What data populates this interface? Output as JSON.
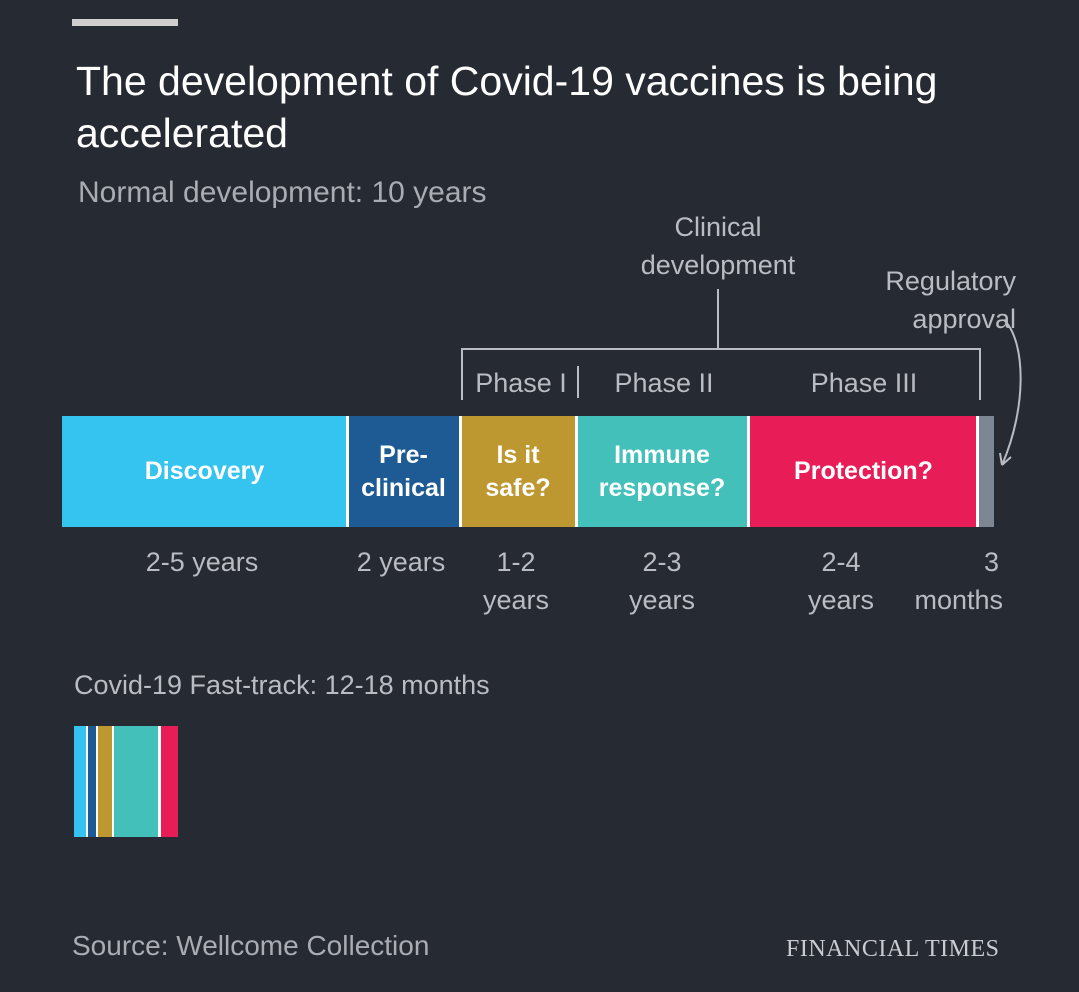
{
  "title": "The development of Covid-19 vaccines is being accelerated",
  "subtitle": "Normal development: 10 years",
  "clinical_label_line1": "Clinical",
  "clinical_label_line2": "development",
  "regulatory_label_line1": "Regulatory",
  "regulatory_label_line2": "approval",
  "phases": [
    "Phase I",
    "Phase II",
    "Phase III"
  ],
  "stages": [
    {
      "line1": "Discovery",
      "line2": "",
      "color": "#35c3ef"
    },
    {
      "line1": "Pre-",
      "line2": "clinical",
      "color": "#1e5b94"
    },
    {
      "line1": "Is it",
      "line2": "safe?",
      "color": "#bd9830"
    },
    {
      "line1": "Immune",
      "line2": "response?",
      "color": "#44c0bb"
    },
    {
      "line1": "Protection?",
      "line2": "",
      "color": "#e81d58"
    },
    {
      "line1": "",
      "line2": "",
      "color": "#7d8693"
    }
  ],
  "durations": [
    {
      "line1": "2-5 years",
      "line2": ""
    },
    {
      "line1": "2 years",
      "line2": ""
    },
    {
      "line1": "1-2",
      "line2": "years"
    },
    {
      "line1": "2-3",
      "line2": "years"
    },
    {
      "line1": "2-4",
      "line2": "years"
    },
    {
      "line1": "3",
      "line2": "months"
    }
  ],
  "fast_track_label": "Covid-19 Fast-track: 12-18 months",
  "source": "Source: Wellcome Collection",
  "brand": "FINANCIAL TIMES"
}
